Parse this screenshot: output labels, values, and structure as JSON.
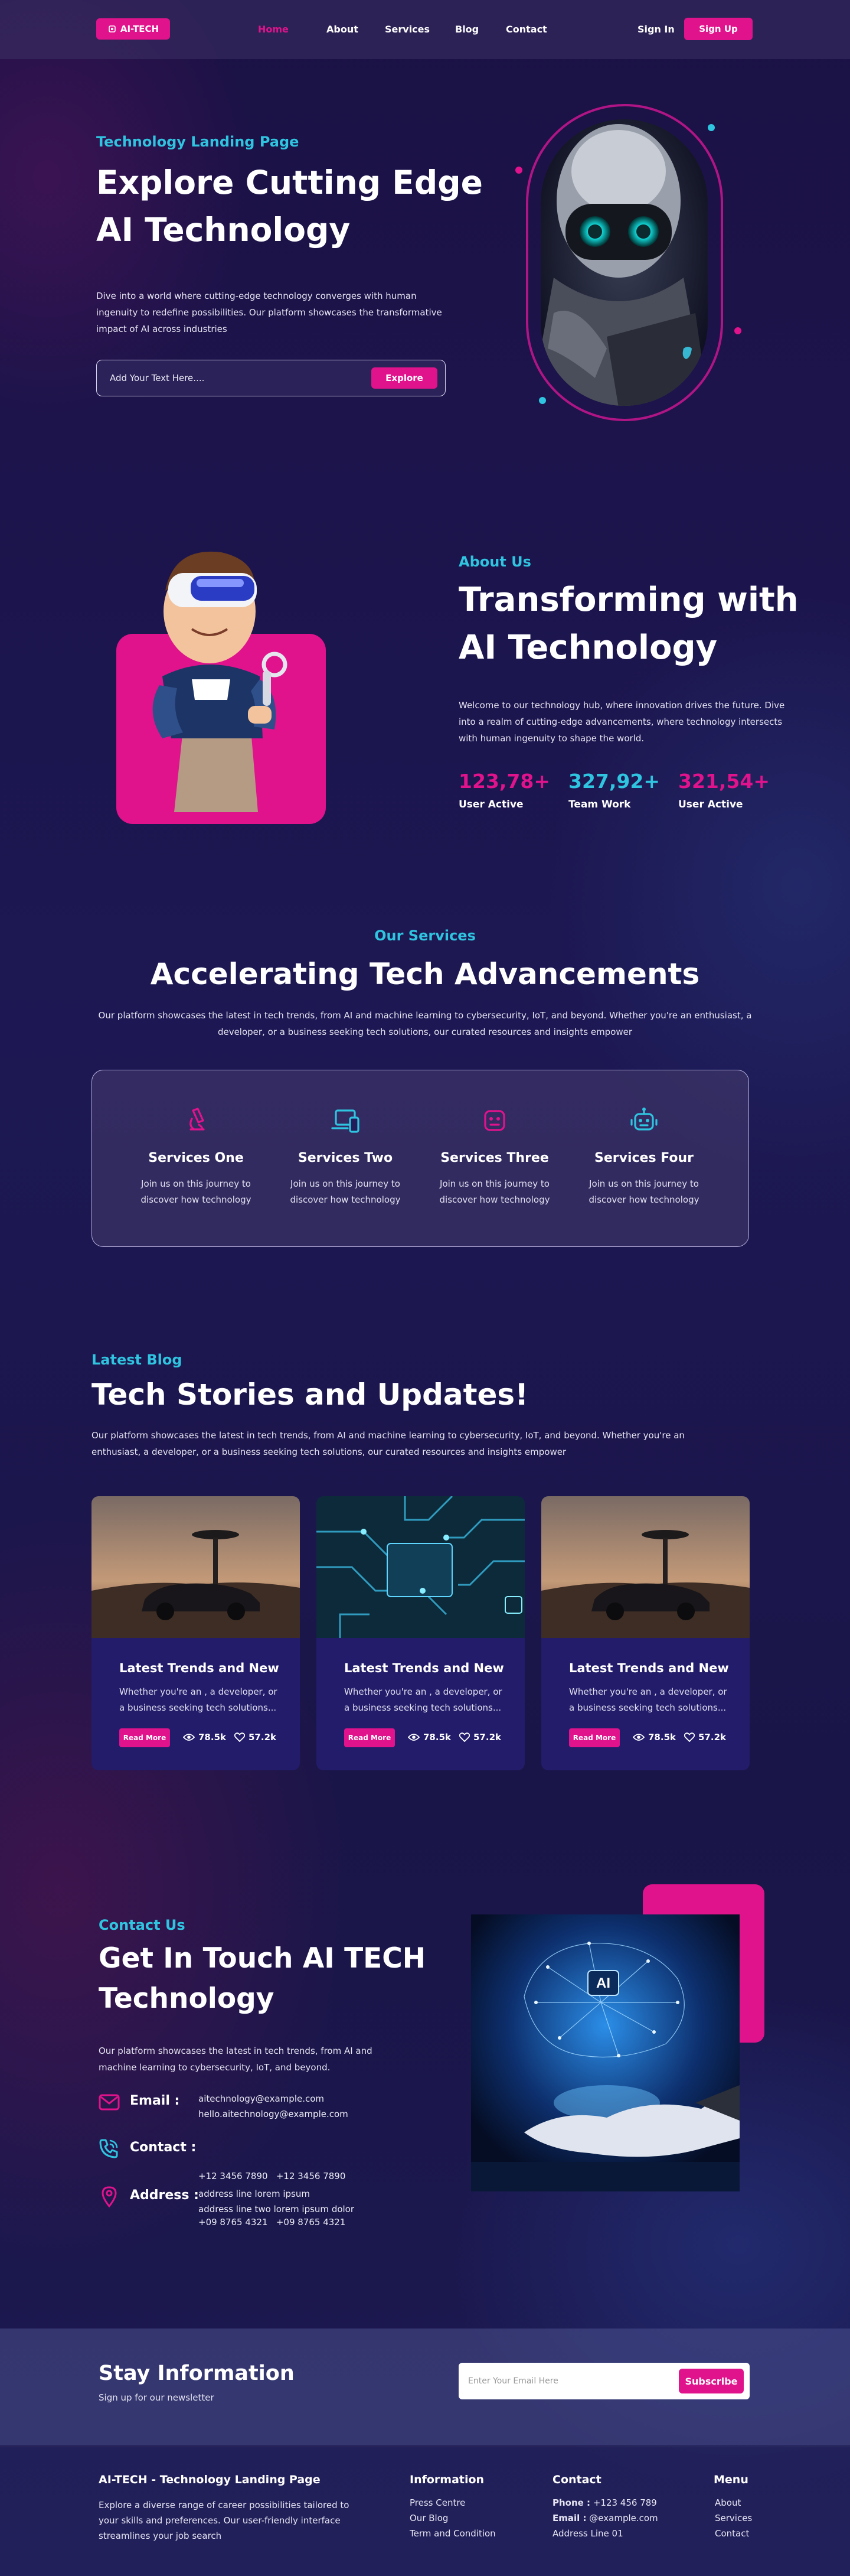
{
  "header": {
    "logo": "AI-TECH",
    "nav": [
      "Home",
      "About",
      "Services",
      "Blog",
      "Contact"
    ],
    "sign_in": "Sign In",
    "sign_up": "Sign Up"
  },
  "hero": {
    "eyebrow": "Technology Landing Page",
    "title_line1": "Explore Cutting Edge",
    "title_line2": "AI Technology",
    "desc": "Dive into a world where cutting-edge technology converges with human ingenuity to redefine possibilities. Our platform showcases the transformative impact of AI across industries",
    "search_placeholder": "Add Your Text Here....",
    "search_button": "Explore"
  },
  "about": {
    "eyebrow": "About Us",
    "title_line1": "Transforming with",
    "title_line2": "AI Technology",
    "desc": "Welcome to our technology hub, where innovation drives the future. Dive into a realm of cutting-edge advancements, where technology intersects with human ingenuity to shape the world.",
    "stats": [
      {
        "value": "123,78+",
        "label": "User Active",
        "color": "#e0138c"
      },
      {
        "value": "327,92+",
        "label": "Team Work",
        "color": "#2fc4e0"
      },
      {
        "value": "321,54+",
        "label": "User Active",
        "color": "#e0138c"
      }
    ]
  },
  "services": {
    "eyebrow": "Our Services",
    "title": "Accelerating Tech Advancements",
    "desc_line1": "Our platform showcases the latest in tech trends, from AI and machine learning to cybersecurity, IoT, and beyond. Whether you're an enthusiast, a",
    "desc_line2": "developer, or a business seeking tech solutions, our curated resources and insights empower",
    "items": [
      {
        "title": "Services One",
        "desc": "Join us on this journey to discover how technology",
        "icon": "microscope-icon"
      },
      {
        "title": "Services Two",
        "desc": "Join us on this journey to discover how technology",
        "icon": "devices-icon"
      },
      {
        "title": "Services Three",
        "desc": "Join us on this journey to discover how technology",
        "icon": "robot-face-icon"
      },
      {
        "title": "Services Four",
        "desc": "Join us on this journey to discover how technology",
        "icon": "robot-head-icon"
      }
    ]
  },
  "blog": {
    "eyebrow": "Latest Blog",
    "title": "Tech Stories and Updates!",
    "desc_line1": "Our platform showcases the latest in tech trends, from AI and machine learning to cybersecurity, IoT, and beyond. Whether you're an",
    "desc_line2": "enthusiast, a developer, or a business seeking tech solutions, our curated resources and insights empower",
    "cards": [
      {
        "title": "Latest Trends and New",
        "desc": "Whether you're an , a developer, or a business seeking tech solutions...",
        "button": "Read More",
        "views": "78.5k",
        "likes": "57.2k"
      },
      {
        "title": "Latest Trends and New",
        "desc": "Whether you're an , a developer, or a business seeking tech solutions...",
        "button": "Read More",
        "views": "78.5k",
        "likes": "57.2k"
      },
      {
        "title": "Latest Trends and New",
        "desc": "Whether you're an , a developer, or a business seeking tech solutions...",
        "button": "Read More",
        "views": "78.5k",
        "likes": "57.2k"
      }
    ]
  },
  "contact": {
    "eyebrow": "Contact Us",
    "title_line1": "Get In Touch AI TECH",
    "title_line2": "Technology",
    "desc": "Our platform showcases the latest in tech trends, from AI and machine learning to cybersecurity, IoT, and beyond.",
    "email_label": "Email :",
    "email1": "aitechnology@example.com",
    "email2": "hello.aitechnology@example.com",
    "phone_label": "Contact :",
    "phone1": "+12 3456 7890   +12 3456 7890",
    "phone2": "+09 8765 4321   +09 8765 4321",
    "address_label": "Address :",
    "address1": "address line lorem ipsum",
    "address2": "address line two lorem ipsum dolor",
    "ai_badge": "AI"
  },
  "newsletter": {
    "title": "Stay Information",
    "subtitle": "Sign up for our newsletter",
    "placeholder": "Enter Your Email Here",
    "button": "Subscribe"
  },
  "footer": {
    "brand": "AI-TECH - Technology Landing Page",
    "brand_desc": "Explore a diverse range of career possibilities tailored to your skills and preferences. Our user-friendly interface streamlines your job search",
    "info_title": "Information",
    "info_links": [
      "Press Centre",
      "Our Blog",
      "Term and Condition"
    ],
    "contact_title": "Contact",
    "phone_label": "Phone :",
    "phone": "+123 456 789",
    "email_label": "Email :",
    "email": "@example.com",
    "address": "Address Line 01",
    "menu_title": "Menu",
    "menu_links": [
      "About",
      "Services",
      "Contact"
    ]
  }
}
